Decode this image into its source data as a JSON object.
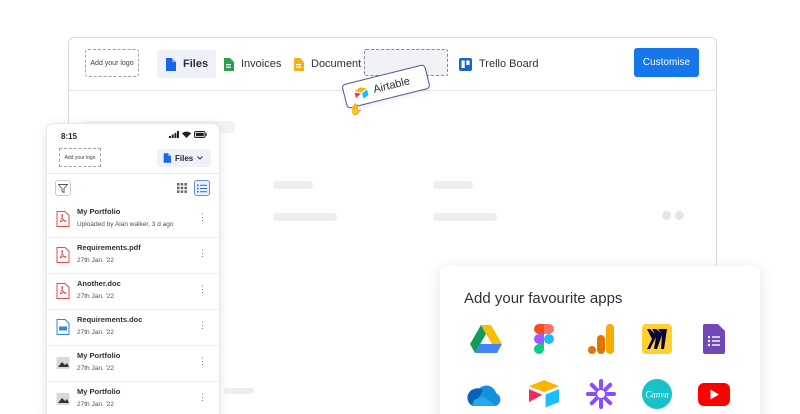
{
  "desktop": {
    "logo_placeholder": "Add your logo",
    "tabs": [
      {
        "label": "Files",
        "icon": "file-icon",
        "active": true
      },
      {
        "label": "Invoices",
        "icon": "invoice-icon",
        "active": false
      },
      {
        "label": "Document",
        "icon": "document-icon",
        "active": false
      },
      {
        "label": "Trello Board",
        "icon": "trello-icon",
        "active": false
      }
    ],
    "customise_label": "Customise"
  },
  "dragging": {
    "label": "Airtable",
    "icon": "airtable-icon"
  },
  "mobile": {
    "time": "8:15",
    "logo_placeholder": "Add your logo",
    "files_label": "Files",
    "items": [
      {
        "name": "My Portfolio",
        "sub": "Uploaded by Alan walker, 3 d ago",
        "icon": "pdf-icon"
      },
      {
        "name": "Requirements.pdf",
        "sub": "27th Jan. '22",
        "icon": "pdf-icon"
      },
      {
        "name": "Another.doc",
        "sub": "27th Jan. '22",
        "icon": "pdf-icon"
      },
      {
        "name": "Requirements.doc",
        "sub": "27th Jan. '22",
        "icon": "doc-icon"
      },
      {
        "name": "My Portfolio",
        "sub": "27th Jan. '22",
        "icon": "image-icon"
      },
      {
        "name": "My Portfolio",
        "sub": "27th Jan. '22",
        "icon": "image-icon"
      }
    ]
  },
  "apps": {
    "title": "Add your favourite apps",
    "icons": [
      "google-drive-icon",
      "figma-icon",
      "google-analytics-icon",
      "miro-icon",
      "google-forms-icon",
      "onedrive-icon",
      "airtable-icon",
      "zapier-icon",
      "canva-icon",
      "youtube-icon"
    ],
    "canva_label": "Canva"
  },
  "colors": {
    "accent": "#1677ea",
    "active_tab_bg": "#eef1f8"
  }
}
